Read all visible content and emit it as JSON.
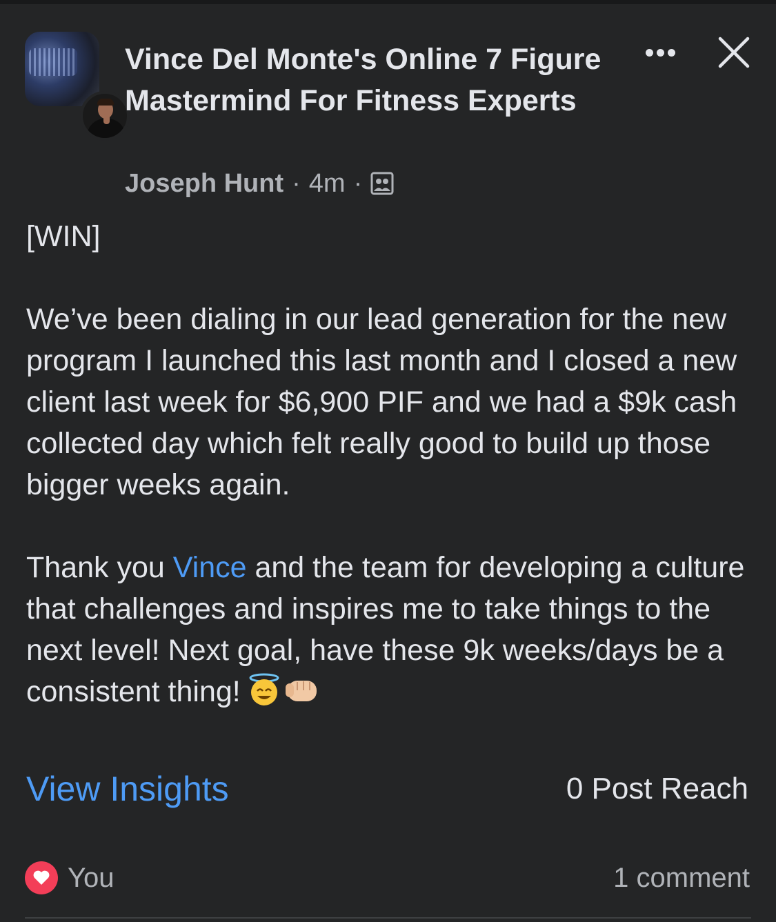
{
  "post": {
    "group_name": "Vince Del Monte's Online 7 Figure Mastermind For Fitness Experts",
    "author": "Joseph Hunt",
    "separator": "·",
    "time": "4m",
    "audience_icon": "group-members-icon",
    "more_icon": "more-options-icon",
    "close_icon": "close-icon",
    "body": {
      "line_win": "[WIN]",
      "paragraph_1": "We’ve been dialing in our lead generation for the new program I launched this last month and I closed a new client last week for $6,900 PIF and we had a $9k cash collected day which felt really good to build up those bigger weeks again.",
      "paragraph_2_before": "Thank you ",
      "paragraph_2_mention": "Vince",
      "paragraph_2_after": " and the team for developing a culture that challenges and inspires me to take things to the next level! Next goal, have these 9k weeks/days be a consistent thing!",
      "emojis": [
        "smiling-face-with-halo-emoji",
        "fist-bump-emoji"
      ]
    }
  },
  "insights": {
    "view_label": "View Insights",
    "reach_label": "0 Post Reach"
  },
  "reactions": {
    "icon": "love-reaction-icon",
    "who": "You",
    "comment_count": "1 comment"
  },
  "colors": {
    "background": "#242526",
    "text": "#e4e6eb",
    "secondary_text": "#b0b3b8",
    "link": "#4e9bf5",
    "love": "#f33e58"
  }
}
